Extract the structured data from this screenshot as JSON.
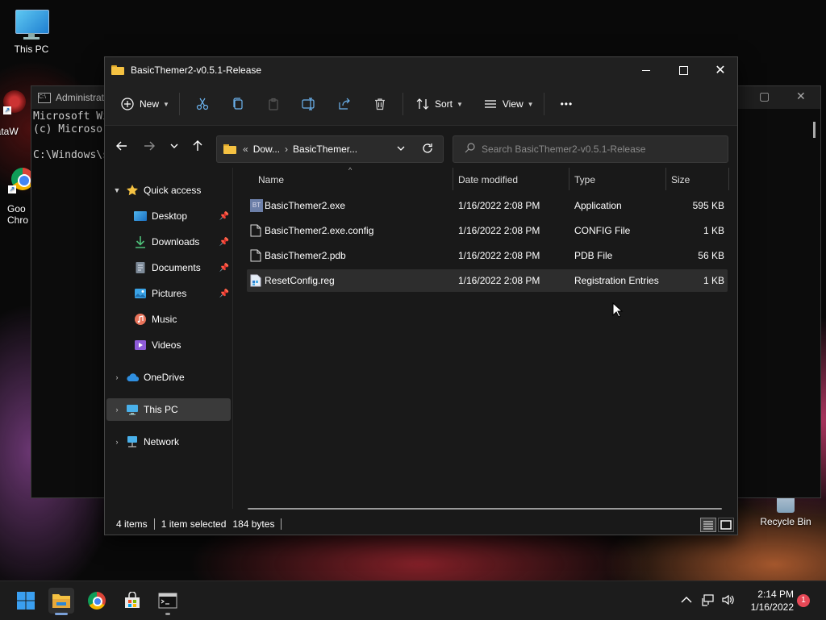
{
  "desktop": {
    "icons": [
      {
        "label": "This PC"
      },
      {
        "label": "DataW"
      },
      {
        "label": "Goo\nChro"
      },
      {
        "label": "Recycle Bin"
      }
    ]
  },
  "cmd": {
    "title": "Administrat",
    "lines": [
      "Microsoft Wi",
      "(c) Microso",
      "",
      "C:\\Windows\\s"
    ]
  },
  "explorer": {
    "title": "BasicThemer2-v0.5.1-Release",
    "toolbar": {
      "new_label": "New",
      "sort_label": "Sort",
      "view_label": "View",
      "more_label": "•••"
    },
    "address": {
      "overflow": "«",
      "crumbs": [
        "Dow...",
        "BasicThemer..."
      ],
      "separator": "›"
    },
    "search": {
      "placeholder": "Search BasicThemer2-v0.5.1-Release"
    },
    "nav": {
      "quick_access": "Quick access",
      "items": [
        {
          "label": "Desktop"
        },
        {
          "label": "Downloads"
        },
        {
          "label": "Documents"
        },
        {
          "label": "Pictures"
        },
        {
          "label": "Music"
        },
        {
          "label": "Videos"
        }
      ],
      "onedrive": "OneDrive",
      "thispc": "This PC",
      "network": "Network"
    },
    "columns": {
      "name": "Name",
      "date": "Date modified",
      "type": "Type",
      "size": "Size"
    },
    "files": [
      {
        "name": "BasicThemer2.exe",
        "date": "1/16/2022 2:08 PM",
        "type": "Application",
        "size": "595 KB"
      },
      {
        "name": "BasicThemer2.exe.config",
        "date": "1/16/2022 2:08 PM",
        "type": "CONFIG File",
        "size": "1 KB"
      },
      {
        "name": "BasicThemer2.pdb",
        "date": "1/16/2022 2:08 PM",
        "type": "PDB File",
        "size": "56 KB"
      },
      {
        "name": "ResetConfig.reg",
        "date": "1/16/2022 2:08 PM",
        "type": "Registration Entries",
        "size": "1 KB"
      }
    ],
    "status": {
      "count": "4 items",
      "selected": "1 item selected",
      "bytes": "184 bytes"
    }
  },
  "taskbar": {
    "time": "2:14 PM",
    "date": "1/16/2022",
    "notifications": "1"
  },
  "colors": {
    "accent": "#0078d4",
    "folder": "#f5c242",
    "notification": "#e74856"
  }
}
